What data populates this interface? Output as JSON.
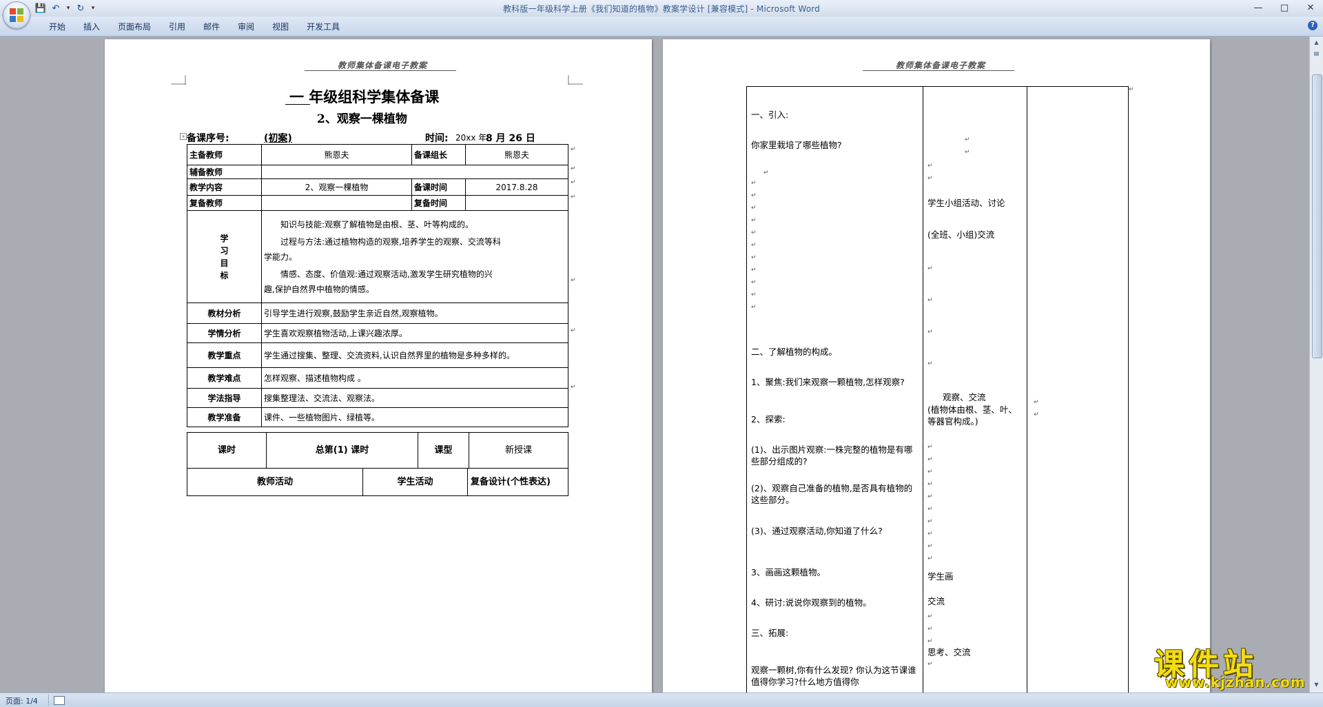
{
  "window": {
    "title": "教科版一年级科学上册《我们知道的植物》教案学设计 [兼容模式] - Microsoft Word"
  },
  "ribbon": {
    "tabs": [
      "开始",
      "插入",
      "页面布局",
      "引用",
      "邮件",
      "审阅",
      "视图",
      "开发工具"
    ]
  },
  "status": {
    "page": "页面: 1/4"
  },
  "page1": {
    "header": "教师集体备课电子教案",
    "title_line": "一 年级组科学集体备课",
    "subtitle": "2、观察一棵植物",
    "meta": {
      "seq_label": "备课序号:",
      "seq_value": "(初案)",
      "time_label": "时间:",
      "time_prefix": "20xx 年",
      "time_value": "8 月 26 日"
    },
    "info": {
      "main_teacher_label": "主备教师",
      "main_teacher": "熊恩夫",
      "group_leader_label": "备课组长",
      "group_leader": "熊恩夫",
      "assistant_label": "辅备教师",
      "content_label": "教学内容",
      "content": "2、观察一棵植物",
      "prep_time_label": "备课时间",
      "prep_time": "2017.8.28",
      "review_teacher_label": "复备教师",
      "review_time_label": "复备时间"
    },
    "objectives_label": [
      "学",
      "习",
      "目",
      "标"
    ],
    "objectives": [
      "知识与技能:观察了解植物是由根、茎、叶等构成的。",
      "过程与方法:通过植物构造的观察,培养学生的观察、交流等科",
      "学能力。",
      "情感、态度、价值观:通过观察活动,激发学生研究植物的兴",
      "趣,保护自然界中植物的情感。"
    ],
    "rows": [
      {
        "label": "教材分析",
        "value": "引导学生进行观察,鼓励学生亲近自然,观察植物。"
      },
      {
        "label": "学情分析",
        "value": "学生喜欢观察植物活动,上课兴趣浓厚。"
      },
      {
        "label": "教学重点",
        "value": "学生通过搜集、整理、交流资料,认识自然界里的植物是多种多样的。"
      },
      {
        "label": "教学难点",
        "value": "怎样观察、描述植物构成 。"
      },
      {
        "label": "学法指导",
        "value": "搜集整理法、交流法、观察法。"
      },
      {
        "label": "教学准备",
        "value": "课件、一些植物图片、绿植等。"
      }
    ],
    "lesson": {
      "hours_label": "课时",
      "total_label": "总第(1) 课时",
      "type_label": "课型",
      "type_value": "新授课"
    },
    "activity_header": {
      "teacher": "教师活动",
      "student": "学生活动",
      "design": "复备设计(个性表达)"
    }
  },
  "page2": {
    "header": "教师集体备课电子教案",
    "teacher_col": [
      "一、引入:",
      "你家里栽培了哪些植物?",
      "二、了解植物的构成。",
      "1、聚焦:我们来观察一颗植物,怎样观察?",
      "2、探索:",
      "(1)、出示图片观察:一株完整的植物是有哪些部分组成的?",
      "(2)、观察自己准备的植物,是否具有植物的这些部分。",
      "(3)、通过观察活动,你知道了什么?",
      "3、画画这颗植物。",
      "4、研讨:说说你观察到的植物。",
      "三、拓展:",
      "观察一颗树,你有什么发现? 你认为这节课谁值得你学习?什么地方值得你"
    ],
    "student_col": [
      "学生小组活动、讨论",
      "(全班、小组)交流",
      "观察、交流",
      "(植物体由根、茎、叶、等器官构成。)",
      "学生画",
      "交流",
      "思考、交流"
    ]
  },
  "watermark": {
    "main": "课件站",
    "url": "www.kjzhan.com"
  },
  "colors": {
    "ribbon": "#dfe8f5",
    "title_text": "#3b5f8f",
    "watermark": "#f2de12"
  }
}
